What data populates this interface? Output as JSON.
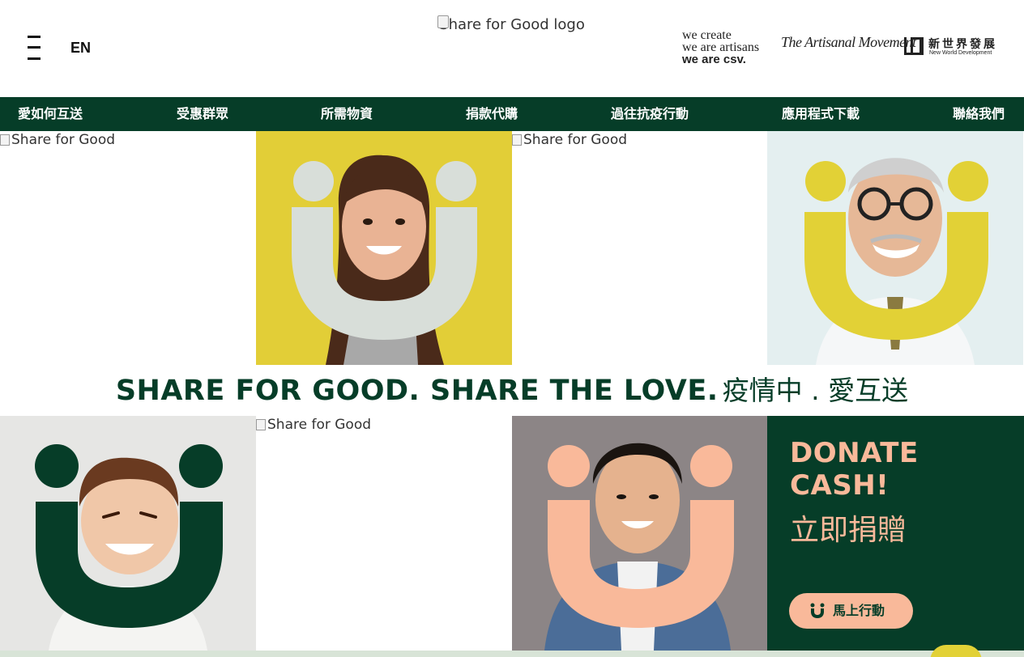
{
  "header": {
    "lang": "EN",
    "logo_alt": "Share for Good logo",
    "csv_line1": "we create",
    "csv_line2": "we are artisans",
    "csv_line3": "we are csv.",
    "signature": "The Artisanal Movement",
    "nwd_cn": "新世界發展",
    "nwd_en": "New World Development"
  },
  "nav": {
    "items": [
      {
        "label": "愛如何互送"
      },
      {
        "label": "受惠群眾"
      },
      {
        "label": "所需物資"
      },
      {
        "label": "捐款代購"
      },
      {
        "label": "過往抗疫行動"
      },
      {
        "label": "應用程式下載"
      },
      {
        "label": "聯絡我們"
      }
    ]
  },
  "tiles": {
    "alt_1": "Share for Good",
    "alt_2": "Share for Good",
    "alt_3": "Share for Good"
  },
  "tagline": {
    "en": "SHARE FOR GOOD. SHARE THE LOVE.",
    "cn": "疫情中 . 愛互送"
  },
  "donate": {
    "title": "DONATE CASH!",
    "cn": "立即捐贈",
    "button_label": "馬上行動"
  },
  "colors": {
    "brand_green": "#063d28",
    "yellow": "#e2d136",
    "peach": "#f9b99a",
    "grey_u": "#d8ded9"
  }
}
